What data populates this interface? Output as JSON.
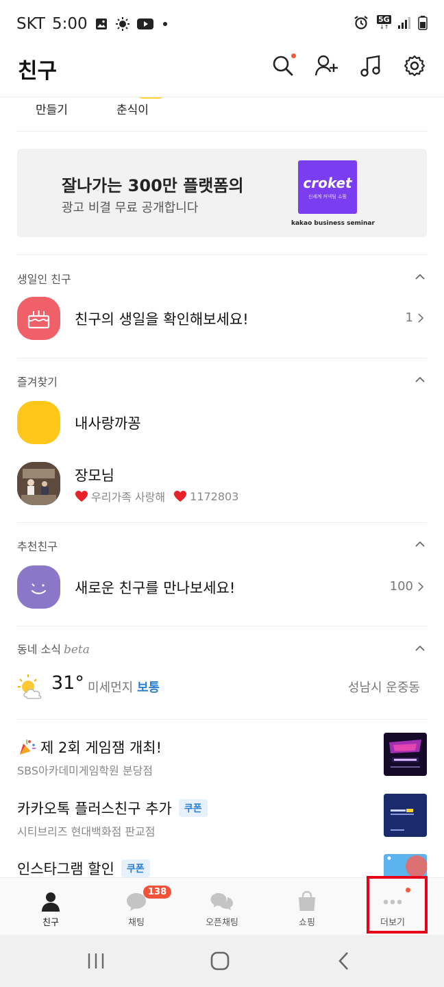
{
  "status_bar": {
    "carrier": "SKT",
    "time": "5:00",
    "network": "5G"
  },
  "header": {
    "title": "친구"
  },
  "top_row": {
    "items": [
      "만들기",
      "춘식이"
    ]
  },
  "ad": {
    "title": "잘나가는 300만 플랫폼의",
    "subtitle": "광고 비결 무료 공개합니다",
    "logo_word": "croket",
    "logo_sub": "신세계 커넥팅 쇼핑",
    "caption": "kakao business seminar"
  },
  "birthday": {
    "header": "생일인 친구",
    "title": "친구의 생일을 확인해보세요!",
    "count": "1"
  },
  "favorites": {
    "header": "즐겨찾기",
    "items": [
      {
        "name": "내사랑까꽁",
        "status": ""
      },
      {
        "name": "장모님",
        "status": "우리가족 사랑해",
        "status2": "1172803"
      }
    ]
  },
  "recommended": {
    "header": "추천친구",
    "title": "새로운 친구를 만나보세요!",
    "count": "100"
  },
  "local_news": {
    "header": "동네 소식",
    "beta": "beta",
    "temperature": "31°",
    "dust_label": "미세먼지",
    "dust_level": "보통",
    "location": "성남시 운중동",
    "items": [
      {
        "title": "제 2회 게임잼 개최!",
        "subtitle": "SBS아카데미게임학원 분당점",
        "tag": ""
      },
      {
        "title": "카카오톡 플러스친구 추가",
        "subtitle": "시티브리즈 현대백화점 판교점",
        "tag": "쿠폰"
      },
      {
        "title": "인스타그램 할인",
        "subtitle": "",
        "tag": "쿠폰"
      }
    ]
  },
  "tabs": [
    {
      "label": "친구",
      "icon": "person-icon"
    },
    {
      "label": "채팅",
      "icon": "chat-icon",
      "badge": "138"
    },
    {
      "label": "오픈채팅",
      "icon": "open-chat-icon"
    },
    {
      "label": "쇼핑",
      "icon": "shopping-bag-icon"
    },
    {
      "label": "더보기",
      "icon": "more-icon"
    }
  ],
  "colors": {
    "accent_yellow": "#ffd331",
    "badge_red": "#f0533a",
    "highlight_red": "#e6001c",
    "link_blue": "#2a7fd4",
    "ad_purple": "#7b3df0"
  }
}
